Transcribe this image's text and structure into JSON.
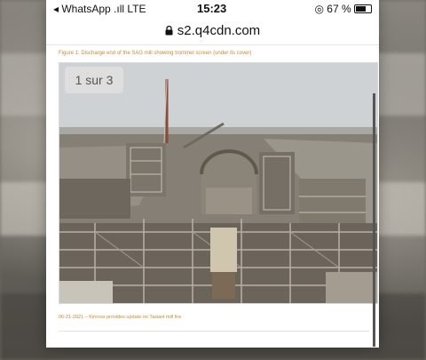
{
  "status_bar": {
    "carrier": "◂ WhatsApp  .ıll  LTE",
    "time": "15:23",
    "battery": "◎ 67 %"
  },
  "browser": {
    "url": "s2.q4cdn.com"
  },
  "article": {
    "figure_caption": "Figure 1: Discharge end of the SAG mill showing trommel screen (under its cover)",
    "gallery_counter": "1 sur 3",
    "news_link": "06-21-2021 – Kinross provides update on Tasiast mill fire"
  },
  "colors": {
    "caption_orange": "#c58a3a",
    "steel_frame": "#b9b2a4",
    "mill_shell": "#8b8478"
  }
}
